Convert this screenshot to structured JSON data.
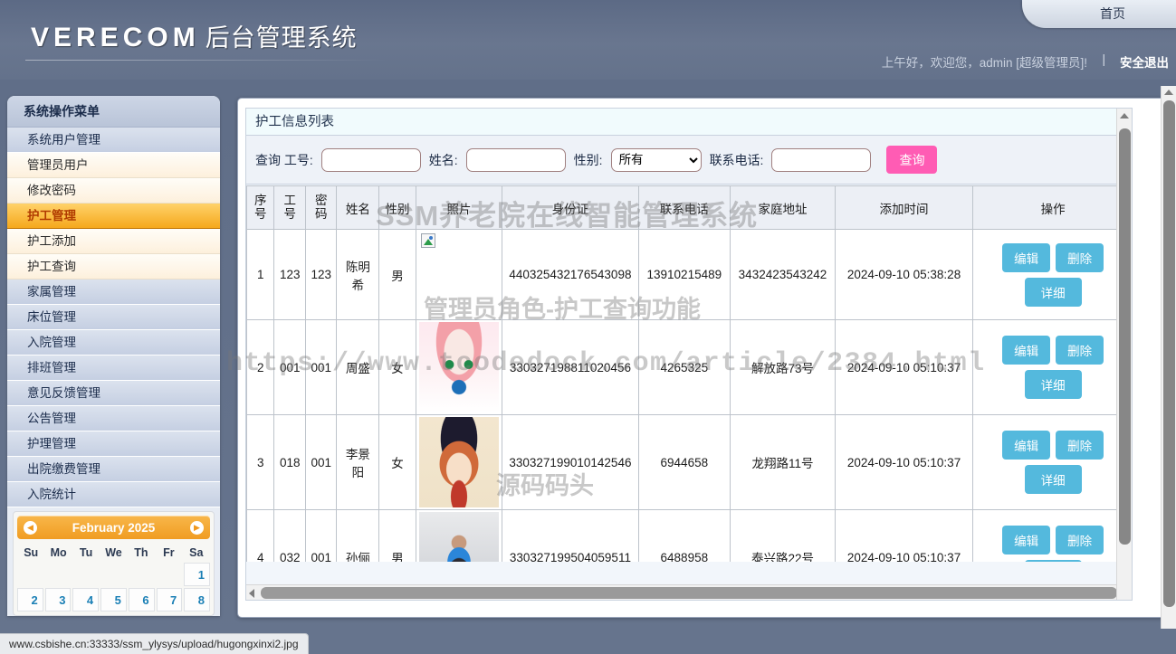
{
  "header": {
    "brand": "VERECOM",
    "brand_sub": "后台管理系统",
    "home_tab": "首页",
    "greeting": "上午好，欢迎您，admin [超级管理员]!",
    "separator": "|",
    "logout": "安全退出"
  },
  "sidebar": {
    "title": "系统操作菜单",
    "items": [
      {
        "label": "系统用户管理",
        "type": "group"
      },
      {
        "label": "管理员用户",
        "type": "sub"
      },
      {
        "label": "修改密码",
        "type": "sub"
      },
      {
        "label": "护工管理",
        "type": "active"
      },
      {
        "label": "护工添加",
        "type": "sub"
      },
      {
        "label": "护工查询",
        "type": "sub"
      },
      {
        "label": "家属管理",
        "type": "group"
      },
      {
        "label": "床位管理",
        "type": "group"
      },
      {
        "label": "入院管理",
        "type": "group"
      },
      {
        "label": "排班管理",
        "type": "group"
      },
      {
        "label": "意见反馈管理",
        "type": "group"
      },
      {
        "label": "公告管理",
        "type": "group"
      },
      {
        "label": "护理管理",
        "type": "group"
      },
      {
        "label": "出院缴费管理",
        "type": "group"
      },
      {
        "label": "入院统计",
        "type": "group"
      }
    ]
  },
  "calendar": {
    "month_label": "February 2025",
    "prev_icon": "chevron-left-icon",
    "next_icon": "chevron-right-icon",
    "dow": [
      "Su",
      "Mo",
      "Tu",
      "We",
      "Th",
      "Fr",
      "Sa"
    ],
    "lead_blanks": 6,
    "days": [
      1,
      2,
      3,
      4,
      5,
      6,
      7,
      8
    ]
  },
  "panel": {
    "title": "护工信息列表"
  },
  "search": {
    "label_id": "查询 工号:",
    "value_id": "",
    "label_name": "姓名:",
    "value_name": "",
    "label_gender": "性别:",
    "gender_selected": "所有",
    "gender_options": [
      "所有",
      "男",
      "女"
    ],
    "label_phone": "联系电话:",
    "value_phone": "",
    "button": "查询"
  },
  "table": {
    "columns": [
      "序 号",
      "工 号",
      "密 码",
      "姓名",
      "性别",
      "照片",
      "身份证",
      "联系电话",
      "家庭地址",
      "添加时间",
      "操作"
    ],
    "rows": [
      {
        "index": "1",
        "work_id": "123",
        "password": "123",
        "name": "陈明希",
        "gender": "男",
        "photo": "broken-image",
        "id_card": "440325432176543098",
        "phone": "13910215489",
        "address": "3432423543242",
        "created": "2024-09-10 05:38:28"
      },
      {
        "index": "2",
        "work_id": "001",
        "password": "001",
        "name": "周盛",
        "gender": "女",
        "photo": "anime-girl-pink-hair",
        "id_card": "330327198811020456",
        "phone": "4265325",
        "address": "解放路73号",
        "created": "2024-09-10 05:10:37"
      },
      {
        "index": "3",
        "work_id": "018",
        "password": "001",
        "name": "李景阳",
        "gender": "女",
        "photo": "anime-girl-hat",
        "id_card": "330327199010142546",
        "phone": "6944658",
        "address": "龙翔路11号",
        "created": "2024-09-10 05:10:37"
      },
      {
        "index": "4",
        "work_id": "032",
        "password": "001",
        "name": "孙俪",
        "gender": "男",
        "photo": "gym-man-photo",
        "id_card": "330327199504059511",
        "phone": "6488958",
        "address": "泰兴路22号",
        "created": "2024-09-10 05:10:37"
      }
    ],
    "actions": {
      "edit": "编辑",
      "delete": "删除",
      "detail": "详细"
    }
  },
  "watermarks": {
    "title": "SSM养老院在线智能管理系统",
    "role": "管理员角色-护工查询功能",
    "url": "https://www.tcodedock.com/article/2384.html",
    "source": "源码码头"
  },
  "statusbar": {
    "url": "www.csbishe.cn:33333/ssm_ylysys/upload/hugongxinxi2.jpg"
  },
  "colors": {
    "accent_orange": "#f5a81c",
    "search_pink": "#ff5cb4",
    "action_blue": "#54b9dd",
    "header_blue": "#64728b"
  }
}
